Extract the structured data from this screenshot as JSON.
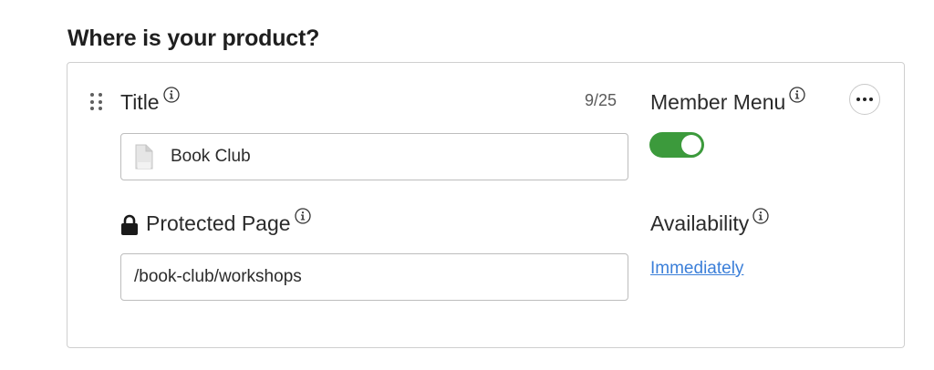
{
  "section": {
    "heading": "Where is your product?"
  },
  "title_field": {
    "label": "Title",
    "counter": "9/25",
    "value": "Book Club"
  },
  "protected_page_field": {
    "label": "Protected Page",
    "value": "/book-club/workshops"
  },
  "member_menu": {
    "label": "Member Menu",
    "enabled": true
  },
  "availability": {
    "label": "Availability",
    "link_text": "Immediately"
  },
  "colors": {
    "toggle_on": "#3c9a3c",
    "link": "#3b7fd9",
    "border": "#cfcfcf"
  },
  "icons": [
    "drag-handle-icon",
    "info-icon",
    "document-icon",
    "lock-icon",
    "more-options-icon"
  ]
}
